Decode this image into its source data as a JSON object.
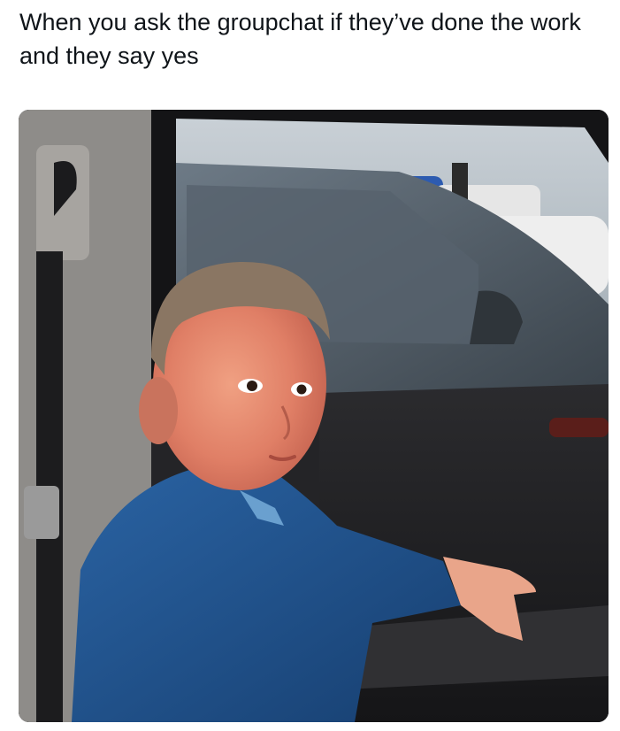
{
  "post": {
    "caption": "When you ask the groupchat if they’ve done the work and they say yes"
  },
  "media": {
    "icon": "photo",
    "subject": "child-in-blue-sweater-in-car",
    "colors": {
      "sweater": "#1f4f8a",
      "face": "#e9896f",
      "car_interior": "#232326",
      "window_glass": "#8c9aa4"
    }
  }
}
